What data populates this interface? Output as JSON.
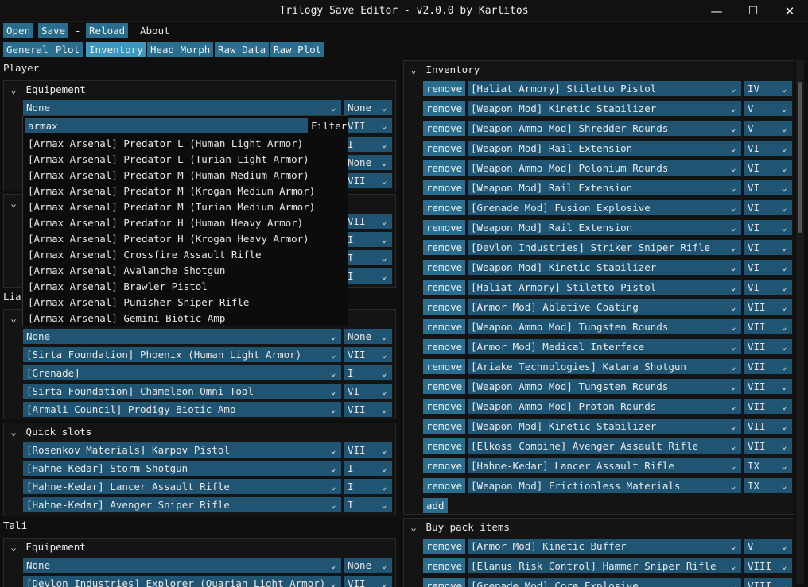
{
  "window": {
    "title": "Trilogy Save Editor - v2.0.0 by Karlitos",
    "minimize": "—",
    "maximize": "☐",
    "close": "✕"
  },
  "menu": {
    "open": "Open",
    "save": "Save",
    "sep": "-",
    "reload": "Reload",
    "about": "About"
  },
  "tabs": [
    "General",
    "Plot",
    "Inventory",
    "Head Morph",
    "Raw Data",
    "Raw Plot"
  ],
  "left": {
    "player_label": "Player",
    "player_equip": {
      "title": "Equipement",
      "row0": {
        "value": "None",
        "level": "None"
      },
      "hidden_levels": [
        "VII",
        "I",
        "None",
        "VII"
      ]
    },
    "second_levels": [
      "VII",
      "I",
      "I",
      "I"
    ],
    "liara_label": "Liar",
    "liara_equip": {
      "rows": [
        {
          "value": "None",
          "level": "None"
        },
        {
          "value": "[Sirta Foundation] Phoenix (Human Light Armor)",
          "level": "VII"
        },
        {
          "value": "[Grenade]",
          "level": "I"
        },
        {
          "value": "[Sirta Foundation] Chameleon Omni-Tool",
          "level": "VI"
        },
        {
          "value": "[Armali Council] Prodigy Biotic Amp",
          "level": "VII"
        }
      ]
    },
    "quick_slots": {
      "title": "Quick slots",
      "rows": [
        {
          "value": "[Rosenkov Materials] Karpov Pistol",
          "level": "VII"
        },
        {
          "value": "[Hahne-Kedar] Storm Shotgun",
          "level": "I"
        },
        {
          "value": "[Hahne-Kedar] Lancer Assault Rifle",
          "level": "I"
        },
        {
          "value": "[Hahne-Kedar] Avenger Sniper Rifle",
          "level": "I"
        }
      ]
    },
    "tali_label": "Tali",
    "tali_equip": {
      "title": "Equipement",
      "rows": [
        {
          "value": "None",
          "level": "None"
        },
        {
          "value": "[Devlon Industries] Explorer (Quarian Light Armor)",
          "level": "VII"
        }
      ]
    }
  },
  "popup": {
    "filter_value": "armax",
    "filter_label": "Filter",
    "options": [
      "[Armax Arsenal] Predator L (Human Light Armor)",
      "[Armax Arsenal] Predator L (Turian Light Armor)",
      "[Armax Arsenal] Predator M (Human Medium Armor)",
      "[Armax Arsenal] Predator M (Krogan Medium Armor)",
      "[Armax Arsenal] Predator M (Turian Medium Armor)",
      "[Armax Arsenal] Predator H (Human Heavy Armor)",
      "[Armax Arsenal] Predator H (Krogan Heavy Armor)",
      "[Armax Arsenal] Crossfire Assault Rifle",
      "[Armax Arsenal] Avalanche Shotgun",
      "[Armax Arsenal] Brawler Pistol",
      "[Armax Arsenal] Punisher Sniper Rifle",
      "[Armax Arsenal] Gemini Biotic Amp"
    ]
  },
  "inventory": {
    "title": "Inventory",
    "remove_label": "remove",
    "add_label": "add",
    "items": [
      {
        "name": "[Haliat Armory] Stiletto Pistol",
        "level": "IV"
      },
      {
        "name": "[Weapon Mod] Kinetic Stabilizer",
        "level": "V"
      },
      {
        "name": "[Weapon Ammo Mod] Shredder Rounds",
        "level": "V"
      },
      {
        "name": "[Weapon Mod] Rail Extension",
        "level": "VI"
      },
      {
        "name": "[Weapon Ammo Mod] Polonium Rounds",
        "level": "VI"
      },
      {
        "name": "[Weapon Mod] Rail Extension",
        "level": "VI"
      },
      {
        "name": "[Grenade Mod] Fusion Explosive",
        "level": "VI"
      },
      {
        "name": "[Weapon Mod] Rail Extension",
        "level": "VI"
      },
      {
        "name": "[Devlon Industries] Striker Sniper Rifle",
        "level": "VI"
      },
      {
        "name": "[Weapon Mod] Kinetic Stabilizer",
        "level": "VI"
      },
      {
        "name": "[Haliat Armory] Stiletto Pistol",
        "level": "VI"
      },
      {
        "name": "[Armor Mod] Ablative Coating",
        "level": "VII"
      },
      {
        "name": "[Weapon Ammo Mod] Tungsten Rounds",
        "level": "VII"
      },
      {
        "name": "[Armor Mod] Medical Interface",
        "level": "VII"
      },
      {
        "name": "[Ariake Technologies] Katana Shotgun",
        "level": "VII"
      },
      {
        "name": "[Weapon Ammo Mod] Tungsten Rounds",
        "level": "VII"
      },
      {
        "name": "[Weapon Ammo Mod] Proton Rounds",
        "level": "VII"
      },
      {
        "name": "[Weapon Mod] Kinetic Stabilizer",
        "level": "VII"
      },
      {
        "name": "[Elkoss Combine] Avenger Assault Rifle",
        "level": "VII"
      },
      {
        "name": "[Hahne-Kedar] Lancer Assault Rifle",
        "level": "IX"
      },
      {
        "name": "[Weapon Mod] Frictionless Materials",
        "level": "IX"
      }
    ]
  },
  "buy_pack": {
    "title": "Buy pack items",
    "items": [
      {
        "name": "[Armor Mod] Kinetic Buffer",
        "level": "V"
      },
      {
        "name": "[Elanus Risk Control] Hammer Sniper Rifle",
        "level": "VIII"
      },
      {
        "name": "[Grenade Mod] Core Explosive",
        "level": "VIII"
      }
    ]
  },
  "icons": {
    "collapse": "chevron-down-icon",
    "dropdown": "chevron-down-icon"
  }
}
